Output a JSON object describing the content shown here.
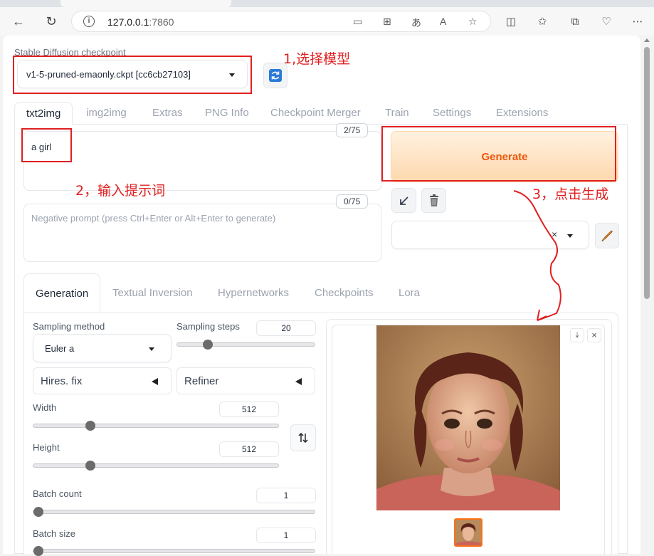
{
  "browser": {
    "url_host": "127.0.0.1",
    "url_port": ":7860",
    "icons": [
      "back-icon",
      "reload-icon",
      "site-info-icon",
      "cast-icon",
      "apps-icon",
      "read-aloud-icon",
      "translate-icon",
      "favorite-icon",
      "split-screen-icon",
      "favorites-bar-icon",
      "collections-icon",
      "extensions-icon",
      "more-icon"
    ]
  },
  "checkpoint": {
    "label": "Stable Diffusion checkpoint",
    "value": "v1-5-pruned-emaonly.ckpt [cc6cb27103]"
  },
  "tabs": [
    "txt2img",
    "img2img",
    "Extras",
    "PNG Info",
    "Checkpoint Merger",
    "Train",
    "Settings",
    "Extensions"
  ],
  "prompt": {
    "value": "a girl",
    "counter": "2/75"
  },
  "negative_prompt": {
    "placeholder": "Negative prompt (press Ctrl+Enter or Alt+Enter to generate)",
    "counter": "0/75"
  },
  "generate_label": "Generate",
  "subtabs": [
    "Generation",
    "Textual Inversion",
    "Hypernetworks",
    "Checkpoints",
    "Lora"
  ],
  "sampling": {
    "method_label": "Sampling method",
    "method_value": "Euler a",
    "steps_label": "Sampling steps",
    "steps_value": "20",
    "steps_fraction": 0.2
  },
  "hires_label": "Hires. fix",
  "refiner_label": "Refiner",
  "width": {
    "label": "Width",
    "value": "512",
    "fraction": 0.22
  },
  "height": {
    "label": "Height",
    "value": "512",
    "fraction": 0.22
  },
  "batch_count": {
    "label": "Batch count",
    "value": "1",
    "fraction": 0.0
  },
  "batch_size": {
    "label": "Batch size",
    "value": "1",
    "fraction": 0.0
  },
  "annotations": {
    "step1": "1,选择模型",
    "step2": "2，输入提示词",
    "step3": "3，点击生成"
  },
  "colors": {
    "annotation": "#e02020",
    "generate_text": "#ea580c"
  }
}
